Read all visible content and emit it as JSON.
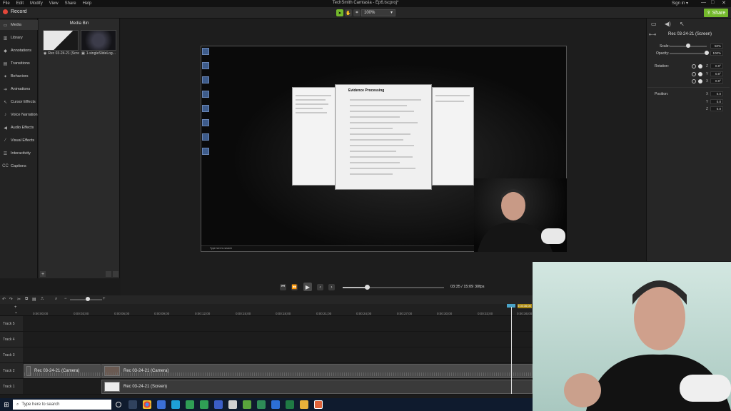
{
  "menubar": {
    "items": [
      "File",
      "Edit",
      "Modify",
      "View",
      "Share",
      "Help"
    ],
    "title": "TechSmith Camtasia - Ep6.tscproj*",
    "signin": "Sign in ▾"
  },
  "toolbar": {
    "record_label": "Record",
    "zoom_value": "100%",
    "share_label": "Share"
  },
  "sidebar": {
    "items": [
      {
        "label": "Media",
        "icon": "film-icon"
      },
      {
        "label": "Library",
        "icon": "library-icon"
      },
      {
        "label": "Annotations",
        "icon": "annotation-icon"
      },
      {
        "label": "Transitions",
        "icon": "transition-icon"
      },
      {
        "label": "Behaviors",
        "icon": "behavior-icon"
      },
      {
        "label": "Animations",
        "icon": "animation-icon"
      },
      {
        "label": "Cursor Effects",
        "icon": "cursor-icon"
      },
      {
        "label": "Voice Narration",
        "icon": "mic-icon"
      },
      {
        "label": "Audio Effects",
        "icon": "audio-icon"
      },
      {
        "label": "Visual Effects",
        "icon": "wand-icon"
      },
      {
        "label": "Interactivity",
        "icon": "interactivity-icon"
      },
      {
        "label": "Captions",
        "icon": "cc-icon"
      }
    ]
  },
  "media_bin": {
    "title": "Media Bin",
    "items": [
      {
        "label": "Rec 03-24-21 (Scre"
      },
      {
        "label": "1-singleSlideLog..."
      }
    ]
  },
  "preview": {
    "dialog_title": "Evidence Processing",
    "desktop_search": "Type here to search"
  },
  "properties": {
    "clip_title": "Rec 03-24-21 (Screen)",
    "scale_label": "Scale:",
    "scale_value": "50%",
    "scale_level": 0.5,
    "opacity_label": "Opacity:",
    "opacity_value": "100%",
    "opacity_level": 1.0,
    "rotation_label": "Rotation:",
    "rotation": [
      {
        "axis": "Z",
        "value": "0.0°"
      },
      {
        "axis": "Y",
        "value": "0.0°"
      },
      {
        "axis": "X",
        "value": "0.0°"
      }
    ],
    "position_label": "Position:",
    "position": [
      {
        "axis": "X",
        "value": "0.0"
      },
      {
        "axis": "Y",
        "value": "0.0"
      },
      {
        "axis": "Z",
        "value": "0.0"
      }
    ]
  },
  "playback": {
    "timecode": "03:35 / 15:09",
    "fps": "30fps",
    "progress": 0.237
  },
  "timeline": {
    "ruler": [
      "0:00:00;00",
      "0:00:03;00",
      "0:00:06;00",
      "0:00:09;00",
      "0:00:12;00",
      "0:00:15;00",
      "0:00:18;00",
      "0:00:21;00",
      "0:00:24;00",
      "0:00:27;00",
      "0:00:30;00",
      "0:00:33;00",
      "0:00:36;00"
    ],
    "playhead_label": "0:03:36;00",
    "zoom_level": 0.55,
    "tracks": [
      {
        "name": "Track 5"
      },
      {
        "name": "Track 4"
      },
      {
        "name": "Track 3"
      },
      {
        "name": "Track 2"
      },
      {
        "name": "Track 1"
      }
    ],
    "clips": {
      "camera_a": "Rec 03-24-21 (Camera)",
      "camera_b": "Rec 03-24-21 (Camera)",
      "screen": "Rec 03-24-21 (Screen)"
    }
  },
  "taskbar": {
    "search_placeholder": "Type here to search"
  },
  "colors": {
    "accent_green": "#74b92c",
    "record_red": "#e4473a",
    "playhead_blue": "#4aa3c7"
  }
}
